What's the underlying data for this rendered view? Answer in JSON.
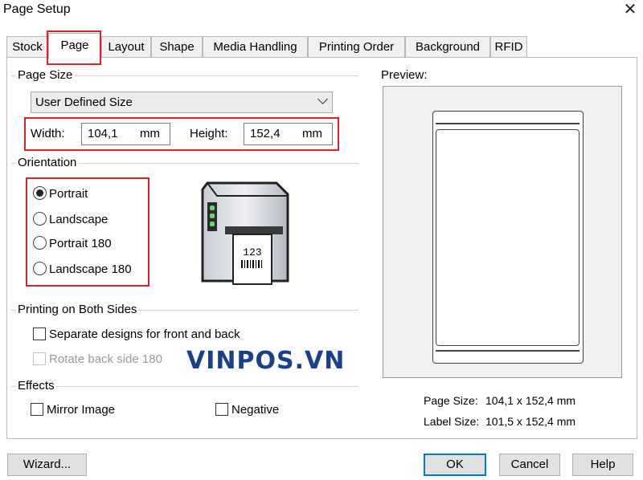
{
  "window": {
    "title": "Page Setup",
    "close_glyph": "✕"
  },
  "tabs": [
    {
      "label": "Stock"
    },
    {
      "label": "Page"
    },
    {
      "label": "Layout"
    },
    {
      "label": "Shape"
    },
    {
      "label": "Media Handling"
    },
    {
      "label": "Printing Order"
    },
    {
      "label": "Background"
    },
    {
      "label": "RFID"
    }
  ],
  "active_tab": "Page",
  "page_size": {
    "group_label": "Page Size",
    "selected_size": "User Defined Size",
    "width_label": "Width:",
    "width_value": "104,1",
    "width_unit": "mm",
    "height_label": "Height:",
    "height_value": "152,4",
    "height_unit": "mm"
  },
  "orientation": {
    "group_label": "Orientation",
    "options": [
      "Portrait",
      "Landscape",
      "Portrait 180",
      "Landscape 180"
    ],
    "selected": "Portrait"
  },
  "printer_illustration": {
    "label_text": "123"
  },
  "both_sides": {
    "group_label": "Printing on Both Sides",
    "separate_label": "Separate designs for front and back",
    "separate_checked": false,
    "rotate_label": "Rotate back side 180",
    "rotate_checked": false,
    "rotate_disabled": true
  },
  "watermark": "VINPOS.VN",
  "effects": {
    "group_label": "Effects",
    "mirror_label": "Mirror Image",
    "mirror_checked": false,
    "negative_label": "Negative",
    "negative_checked": false
  },
  "preview": {
    "label": "Preview:",
    "page_size_label": "Page Size:",
    "page_size_value": "104,1 x 152,4 mm",
    "label_size_label": "Label Size:",
    "label_size_value": "101,5 x 152,4 mm"
  },
  "buttons": {
    "wizard": "Wizard...",
    "ok": "OK",
    "cancel": "Cancel",
    "help": "Help"
  },
  "colors": {
    "highlight": "#e0202a",
    "default_button_border": "#0078d7",
    "watermark": "#1c3f8c"
  }
}
